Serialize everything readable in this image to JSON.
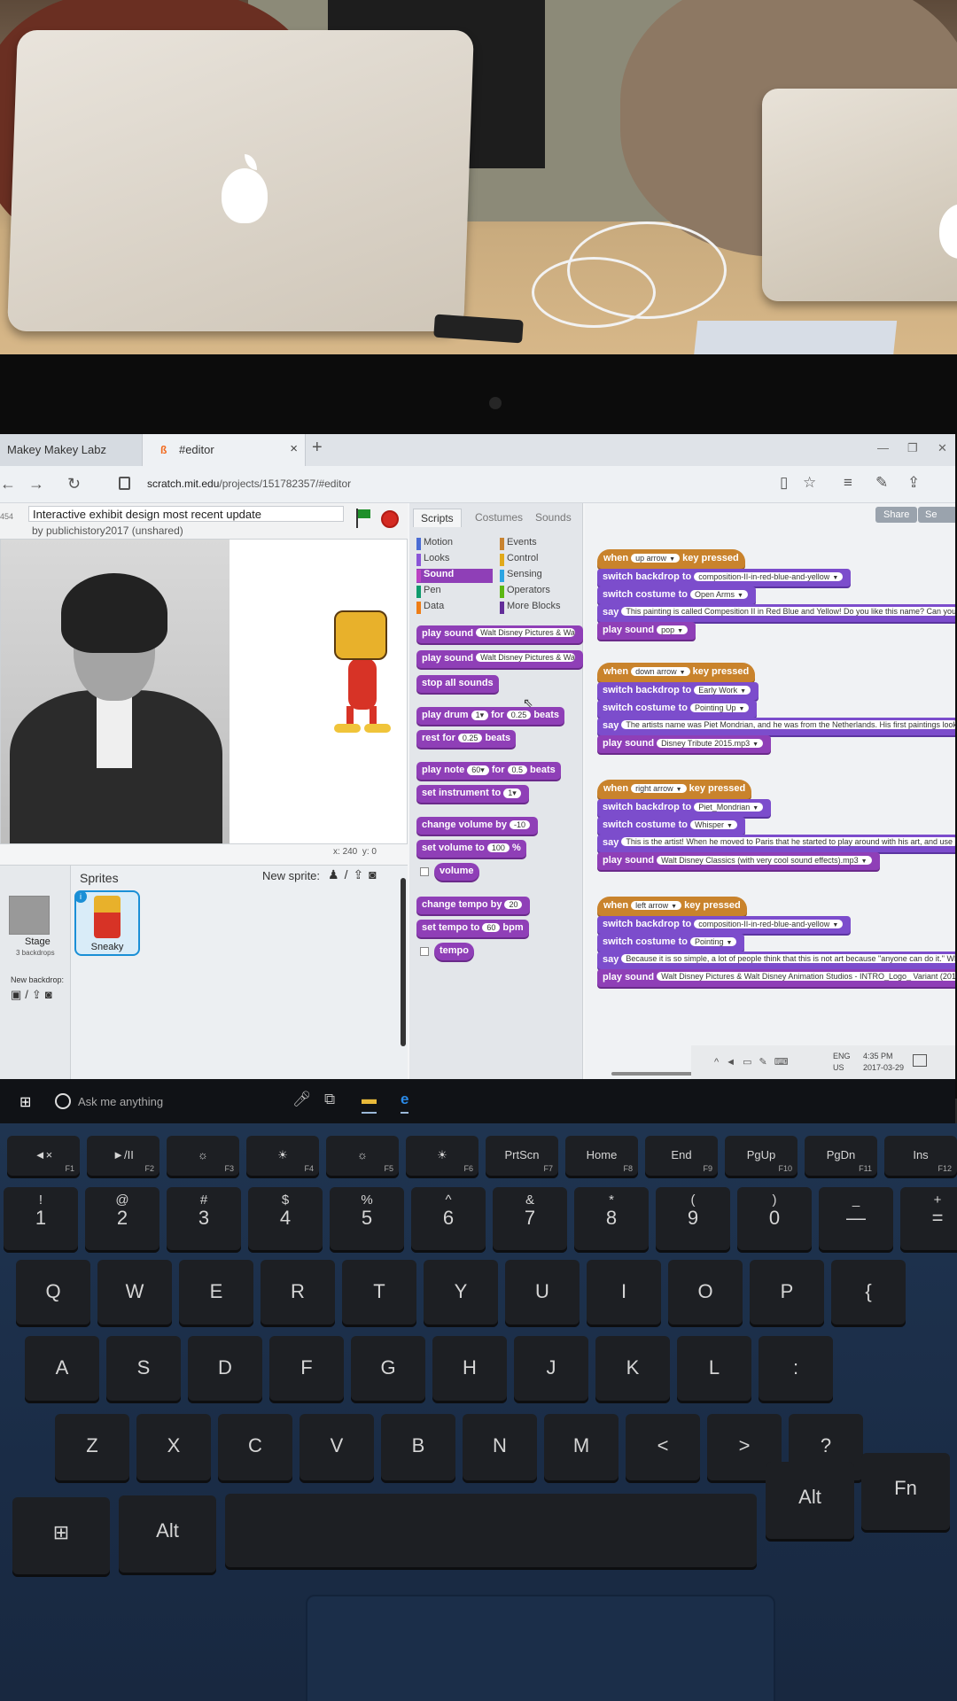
{
  "browser": {
    "tabs": [
      {
        "label": "Makey Makey Labz"
      },
      {
        "label": "#editor",
        "close": "×"
      }
    ],
    "new_tab": "+",
    "url_domain": "scratch.mit.edu",
    "url_path": "/projects/151782357/#editor"
  },
  "project": {
    "title": "Interactive exhibit design most recent update",
    "author": "by publichistory2017 (unshared)",
    "left_mini": "454"
  },
  "stage": {
    "x_label": "x:",
    "x_value": "240",
    "y_label": "y:",
    "y_value": "0"
  },
  "sprites_pane": {
    "title": "Sprites",
    "new_sprite_label": "New sprite:",
    "stage_label": "Stage",
    "backdrops_count": "3 backdrops",
    "new_backdrop_label": "New backdrop:",
    "sprites": [
      {
        "name": "Sneaky",
        "info": "i"
      }
    ]
  },
  "palette": {
    "tabs": [
      "Scripts",
      "Costumes",
      "Sounds"
    ],
    "active_tab": "Scripts",
    "categories_left": [
      {
        "label": "Motion",
        "color": "#4a6cd4"
      },
      {
        "label": "Looks",
        "color": "#8a55d7"
      },
      {
        "label": "Sound",
        "color": "#bb42c3"
      },
      {
        "label": "Pen",
        "color": "#0e9a6c"
      },
      {
        "label": "Data",
        "color": "#ee7d16"
      }
    ],
    "categories_right": [
      {
        "label": "Events",
        "color": "#c88330"
      },
      {
        "label": "Control",
        "color": "#e1a91a"
      },
      {
        "label": "Sensing",
        "color": "#2ca5e2"
      },
      {
        "label": "Operators",
        "color": "#5cb712"
      },
      {
        "label": "More Blocks",
        "color": "#632d99"
      }
    ],
    "active_category": "Sound",
    "blocks": {
      "play_sound_1": {
        "label": "play sound",
        "arg": "Walt Disney Pictures & Walt D"
      },
      "play_sound_2": {
        "label": "play sound",
        "arg": "Walt Disney Pictures & Walt D"
      },
      "stop_all": {
        "label": "stop all sounds"
      },
      "play_drum": {
        "label": "play drum",
        "arg1": "1▾",
        "mid": "for",
        "arg2": "0.25",
        "tail": "beats"
      },
      "rest_for": {
        "label": "rest for",
        "arg": "0.25",
        "tail": "beats"
      },
      "play_note": {
        "label": "play note",
        "arg1": "60▾",
        "mid": "for",
        "arg2": "0.5",
        "tail": "beats"
      },
      "set_instrument": {
        "label": "set instrument to",
        "arg": "1▾"
      },
      "change_volume": {
        "label": "change volume by",
        "arg": "-10"
      },
      "set_volume": {
        "label": "set volume to",
        "arg": "100",
        "tail": "%"
      },
      "volume": {
        "label": "volume"
      },
      "change_tempo": {
        "label": "change tempo by",
        "arg": "20"
      },
      "set_tempo": {
        "label": "set tempo to",
        "arg": "60",
        "tail": "bpm"
      },
      "tempo": {
        "label": "tempo"
      }
    }
  },
  "scripts_area": {
    "share_label": "Share",
    "share2_label": "Se",
    "scripts": [
      {
        "key": "up arrow",
        "backdrop": "composition-II-in-red-blue-and-yellow",
        "costume": "Open Arms",
        "say": "This painting is called Compesition II in Red Blue and Yellow! Do you like this name? Can you thi",
        "sound": "pop"
      },
      {
        "key": "down arrow",
        "backdrop": "Early Work",
        "costume": "Pointing Up",
        "say": "The artists name was Piet Mondrian, and he was from the Netherlands. His first paintings looked",
        "sound": "Disney Tribute 2015.mp3"
      },
      {
        "key": "right arrow",
        "backdrop": "Piet_Mondrian",
        "costume": "Whisper",
        "say": "This is the artist! When he moved to Paris that he started to play around with his art, and use s",
        "sound": "Walt Disney Classics (with very cool sound effects).mp3"
      },
      {
        "key": "left arrow",
        "backdrop": "composition-II-in-red-blue-and-yellow",
        "costume": "Pointing",
        "say": "Because it is so simple, a lot of people think that this is not art because \"anyone can do it.\" Wh",
        "sound": "Walt Disney Pictures & Walt Disney Animation Studios - INTRO_Logo_ Variant (2011) [1"
      }
    ],
    "labels": {
      "when": "when",
      "key_pressed": "key pressed",
      "switch_backdrop": "switch backdrop to",
      "switch_costume": "switch costume to",
      "say": "say",
      "play_sound": "play sound"
    }
  },
  "tray": {
    "lang_1": "ENG",
    "lang_2": "US",
    "time": "4:35 PM",
    "date": "2017-03-29"
  },
  "taskbar": {
    "search_placeholder": "Ask me anything"
  },
  "keyboard": {
    "fn_row": [
      {
        "main": "◄×",
        "fn": "F1"
      },
      {
        "main": "►/II",
        "fn": "F2"
      },
      {
        "main": "☼",
        "fn": "F3"
      },
      {
        "main": "☀",
        "fn": "F4"
      },
      {
        "main": "☼",
        "fn": "F5"
      },
      {
        "main": "☀",
        "fn": "F6"
      },
      {
        "main": "PrtScn",
        "fn": "F7"
      },
      {
        "main": "Home",
        "fn": "F8"
      },
      {
        "main": "End",
        "fn": "F9"
      },
      {
        "main": "PgUp",
        "fn": "F10"
      },
      {
        "main": "PgDn",
        "fn": "F11"
      },
      {
        "main": "Ins",
        "fn": "F12"
      }
    ],
    "num_row": [
      {
        "top": "!",
        "main": "1"
      },
      {
        "top": "@",
        "main": "2"
      },
      {
        "top": "#",
        "main": "3"
      },
      {
        "top": "$",
        "main": "4"
      },
      {
        "top": "%",
        "main": "5"
      },
      {
        "top": "^",
        "main": "6"
      },
      {
        "top": "&",
        "main": "7"
      },
      {
        "top": "*",
        "main": "8"
      },
      {
        "top": "(",
        "main": "9"
      },
      {
        "top": ")",
        "main": "0"
      },
      {
        "top": "_",
        "main": "—"
      },
      {
        "top": "+",
        "main": "="
      }
    ],
    "q_row": [
      "Q",
      "W",
      "E",
      "R",
      "T",
      "Y",
      "U",
      "I",
      "O",
      "P",
      "{"
    ],
    "a_row": [
      "A",
      "S",
      "D",
      "F",
      "G",
      "H",
      "J",
      "K",
      "L",
      ":"
    ],
    "z_row": [
      "Z",
      "X",
      "C",
      "V",
      "B",
      "N",
      "M",
      "<",
      ">",
      "?"
    ],
    "bottom": {
      "alt_left": "Alt",
      "alt_right": "Alt",
      "fn": "Fn"
    }
  }
}
